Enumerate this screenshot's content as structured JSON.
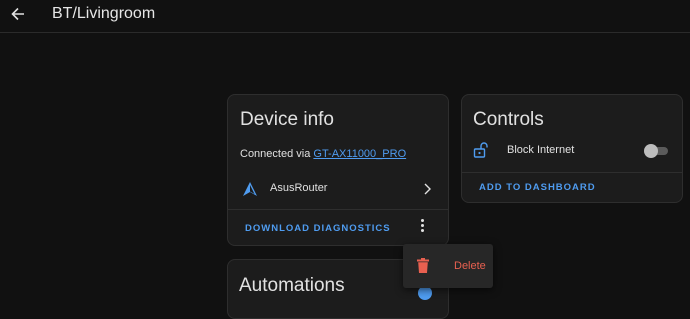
{
  "header": {
    "title": "BT/Livingroom",
    "back_icon": "arrow-left-icon"
  },
  "device_info": {
    "title": "Device info",
    "connected_prefix": "Connected via ",
    "connected_link": "GT-AX11000_PRO",
    "integration": {
      "label": "AsusRouter",
      "icon": "asusrouter-logo-icon"
    },
    "download_label": "DOWNLOAD DIAGNOSTICS"
  },
  "controls": {
    "title": "Controls",
    "entities": [
      {
        "label": "Block Internet",
        "icon": "lock-open-icon",
        "state": "off"
      }
    ],
    "add_label": "ADD TO DASHBOARD"
  },
  "automations": {
    "title": "Automations"
  },
  "overflow_menu": {
    "items": [
      {
        "label": "Delete",
        "icon": "trash-icon"
      }
    ]
  },
  "colors": {
    "background": "#111111",
    "card": "#1c1c1c",
    "accent": "#4f9cf0",
    "danger": "#e86050"
  }
}
